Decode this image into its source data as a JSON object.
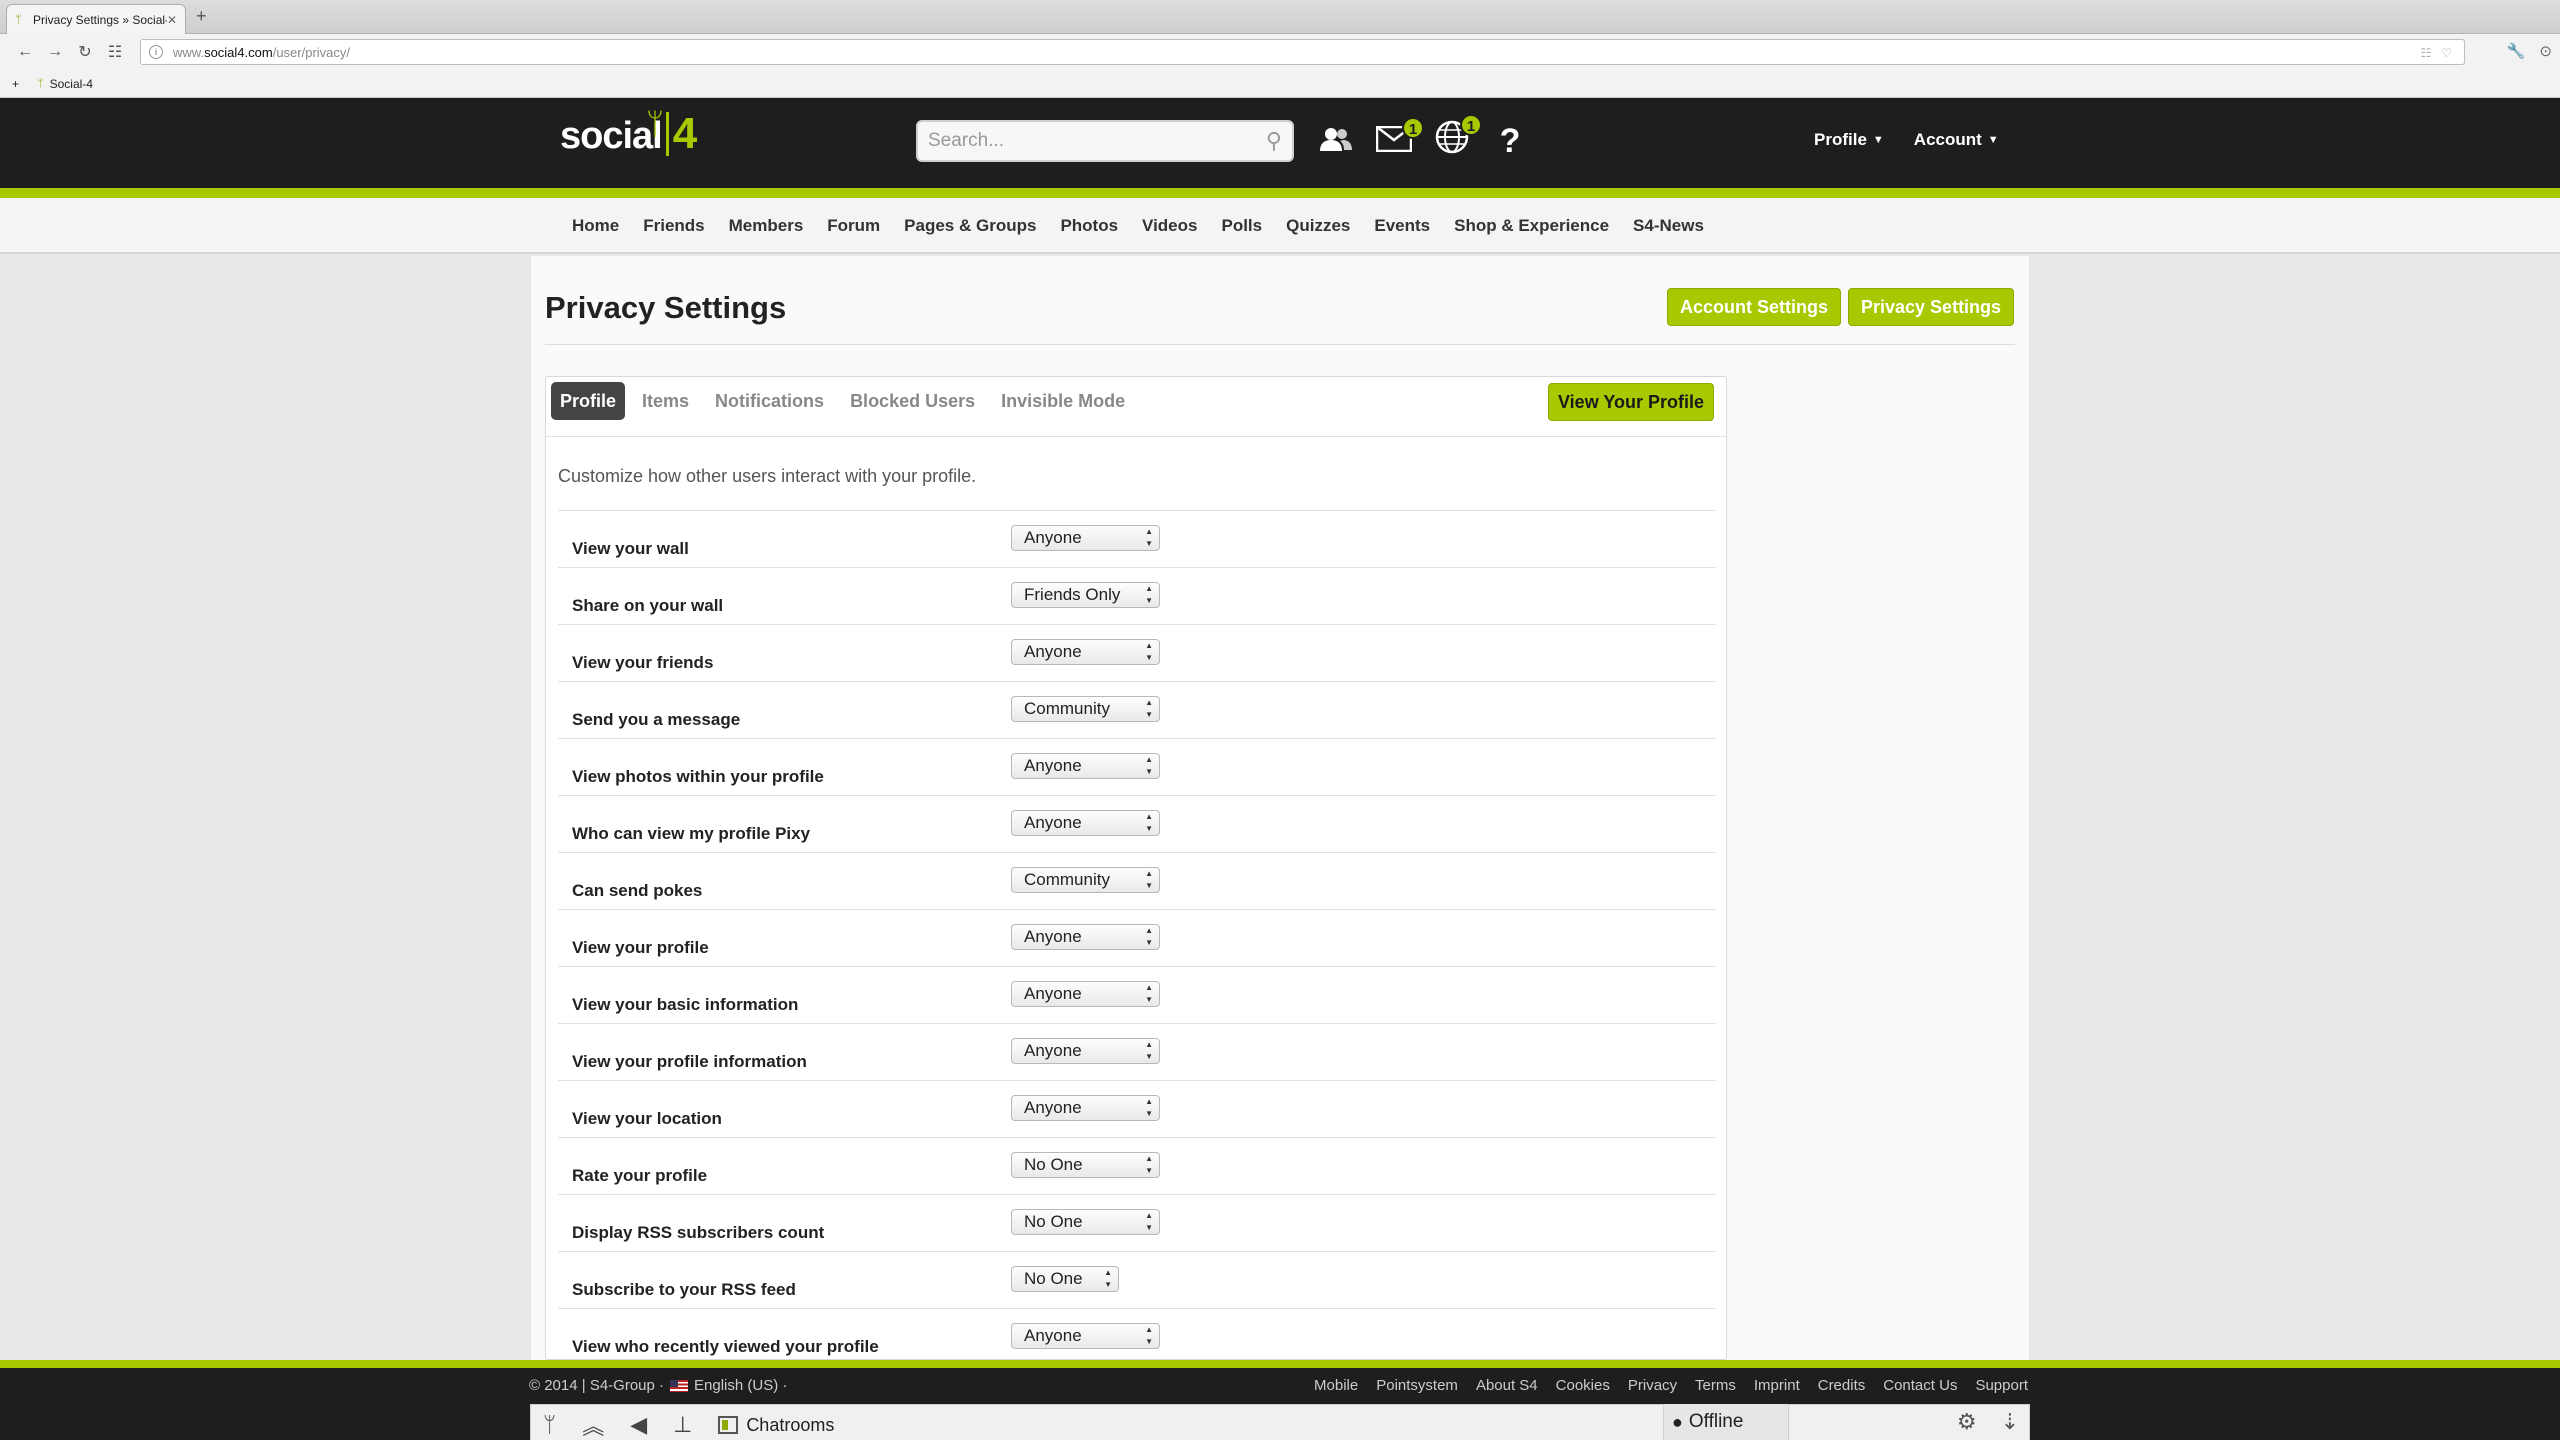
{
  "browser": {
    "tab_title": "Privacy Settings » Social-4",
    "url_prefix": "www.",
    "url_host": "social4.com",
    "url_path": "/user/privacy/",
    "bookmark": "Social-4"
  },
  "header": {
    "logo_text": "social",
    "logo_num": "4",
    "search_placeholder": "Search...",
    "messages_badge": "1",
    "notifications_badge": "1",
    "help_glyph": "?",
    "menus": [
      "Profile",
      "Account"
    ]
  },
  "nav": [
    "Home",
    "Friends",
    "Members",
    "Forum",
    "Pages & Groups",
    "Photos",
    "Videos",
    "Polls",
    "Quizzes",
    "Events",
    "Shop & Experience",
    "S4-News"
  ],
  "page": {
    "title": "Privacy Settings",
    "account_settings_btn": "Account Settings",
    "privacy_settings_btn": "Privacy Settings"
  },
  "tabs": [
    "Profile",
    "Items",
    "Notifications",
    "Blocked Users",
    "Invisible Mode"
  ],
  "view_profile_btn": "View Your Profile",
  "intro": "Customize how other users interact with your profile.",
  "settings": [
    {
      "label": "View your wall",
      "value": "Anyone"
    },
    {
      "label": "Share on your wall",
      "value": "Friends Only"
    },
    {
      "label": "View your friends",
      "value": "Anyone"
    },
    {
      "label": "Send you a message",
      "value": "Community"
    },
    {
      "label": "View photos within your profile",
      "value": "Anyone"
    },
    {
      "label": "Who can view my profile Pixy",
      "value": "Anyone"
    },
    {
      "label": "Can send pokes",
      "value": "Community"
    },
    {
      "label": "View your profile",
      "value": "Anyone"
    },
    {
      "label": "View your basic information",
      "value": "Anyone"
    },
    {
      "label": "View your profile information",
      "value": "Anyone"
    },
    {
      "label": "View your location",
      "value": "Anyone"
    },
    {
      "label": "Rate your profile",
      "value": "No One"
    },
    {
      "label": "Display RSS subscribers count",
      "value": "No One"
    },
    {
      "label": "Subscribe to your RSS feed",
      "value": "No One"
    },
    {
      "label": "View who recently viewed your profile",
      "value": "Anyone"
    }
  ],
  "footer": {
    "copyright": "© 2014 | S4-Group ·",
    "language": "English (US) ·",
    "links": [
      "Mobile",
      "Pointsystem",
      "About S4",
      "Cookies",
      "Privacy",
      "Terms",
      "Imprint",
      "Credits",
      "Contact Us",
      "Support"
    ]
  },
  "dock": {
    "chatrooms": "Chatrooms",
    "status": "Offline"
  },
  "colors": {
    "accent": "#a8c800",
    "header_bg": "#1e1e1e"
  }
}
